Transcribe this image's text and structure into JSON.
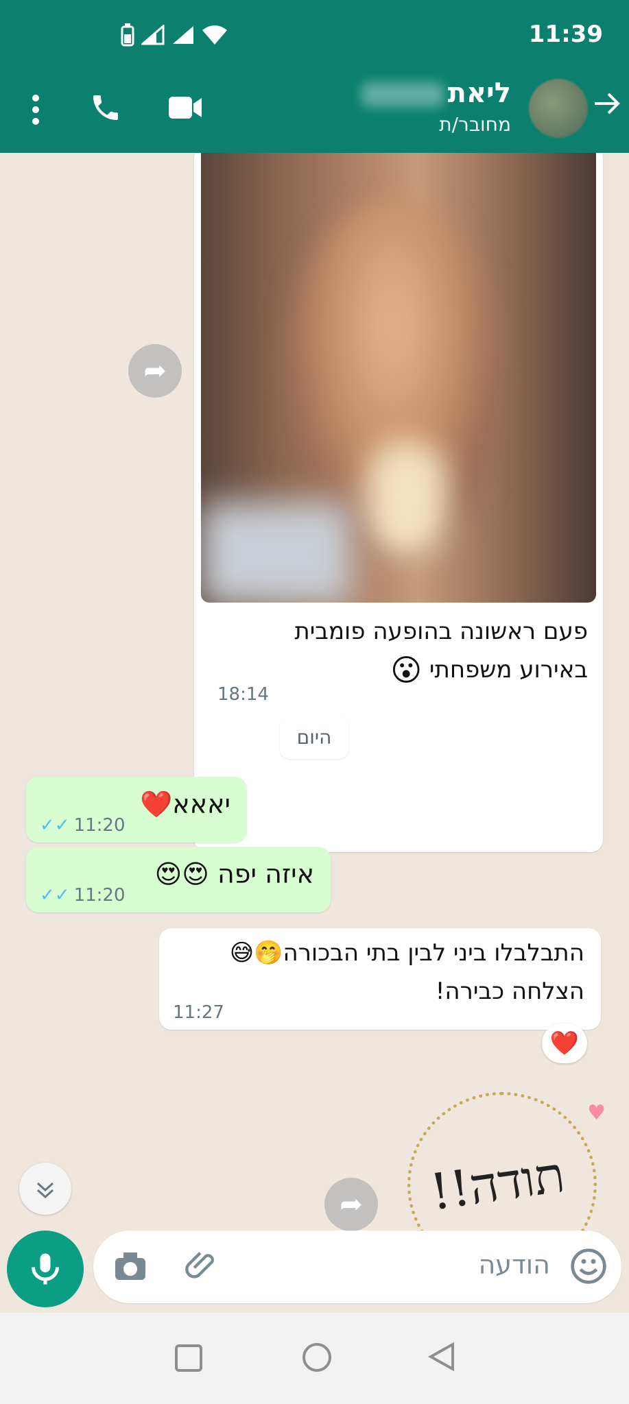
{
  "statusbar": {
    "time": "11:39"
  },
  "header": {
    "contact_name": "ליאת",
    "contact_status": "מחובר/ת"
  },
  "messages": {
    "photo_caption_line1": "פעם ראשונה בהופעה פומבית",
    "photo_caption_line2": "באירוע משפחתי",
    "photo_caption_emoji": "😮",
    "photo_time": "18:14",
    "date_chip": "היום",
    "out1_text": "יאאא",
    "out1_emoji": "❤️",
    "out1_time": "11:20",
    "out2_text": "איזה יפה",
    "out2_emoji": "😍😍",
    "out2_time": "11:20",
    "in1_line1": "התבלבלו ביני לבין בתי הבכורה",
    "in1_line1_emoji": "🤭😅",
    "in1_line2": "הצלחה כבירה!",
    "in1_time": "11:27",
    "in1_reaction": "❤️",
    "sticker_text": "תודה!!"
  },
  "composer": {
    "placeholder": "הודעה"
  },
  "colors": {
    "header": "#0b806e",
    "outgoing_bubble": "#d9fdd3",
    "mic_button": "#0b9e84",
    "ticks": "#53bdeb"
  },
  "icons": [
    "battery-icon",
    "signal-icon",
    "wifi-icon",
    "more-icon",
    "phone-icon",
    "video-icon",
    "back-icon",
    "forward-icon",
    "chevron-down-icon",
    "mic-icon",
    "camera-icon",
    "attach-icon",
    "emoji-icon",
    "nav-square-icon",
    "nav-circle-icon",
    "nav-back-icon"
  ]
}
